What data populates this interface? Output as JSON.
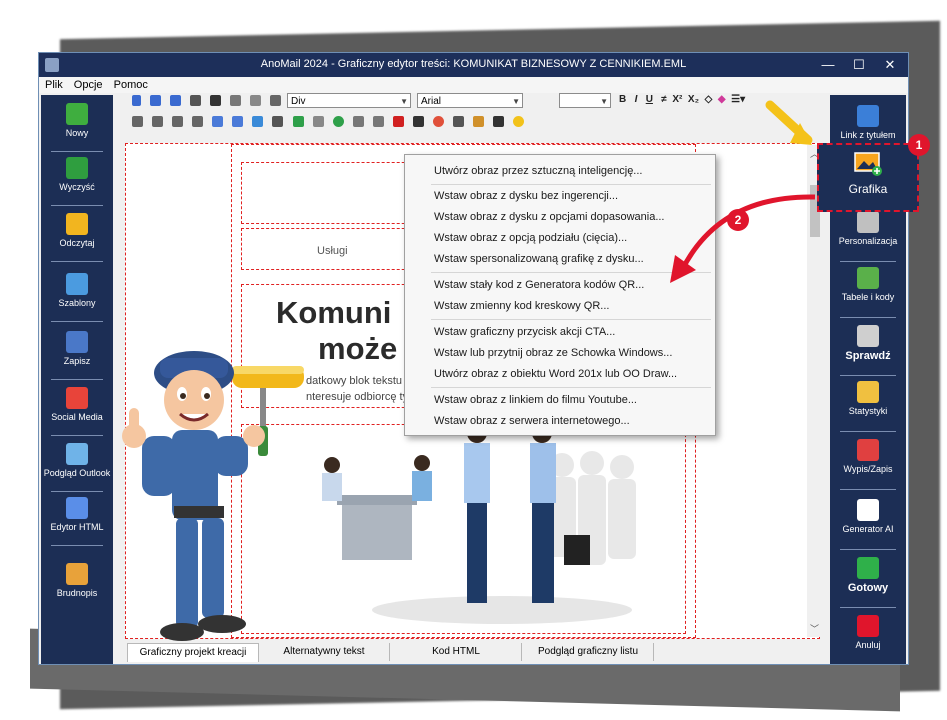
{
  "window": {
    "title": "AnoMail 2024 - Graficzny edytor treści: KOMUNIKAT BIZNESOWY Z CENNIKIEM.EML",
    "minimize": "—",
    "maximize": "☐",
    "close": "✕"
  },
  "menubar": [
    "Plik",
    "Opcje",
    "Pomoc"
  ],
  "toolbar": {
    "style_combo": "Div",
    "font_combo": "Arial",
    "size_combo": ""
  },
  "left_sidebar": [
    {
      "label": "Nowy",
      "icon": "new-document-icon",
      "color": "#3fae3f"
    },
    {
      "label": "Wyczyść",
      "icon": "recycle-icon",
      "color": "#2f9e3f"
    },
    {
      "label": "Odczytaj",
      "icon": "folder-open-icon",
      "color": "#f2b51f"
    },
    {
      "label": "Szablony",
      "icon": "templates-icon",
      "color": "#4b9be0"
    },
    {
      "label": "Zapisz",
      "icon": "save-icon",
      "color": "#4a78c8"
    },
    {
      "label": "Social Media",
      "icon": "social-media-icon",
      "color": "#e8443a"
    },
    {
      "label": "Podgląd Outlook",
      "icon": "outlook-icon",
      "color": "#6fb3e8"
    },
    {
      "label": "Edytor HTML",
      "icon": "html-editor-icon",
      "color": "#5a8ee8"
    },
    {
      "label": "Brudnopis",
      "icon": "draft-icon",
      "color": "#e8a23a"
    }
  ],
  "right_sidebar": [
    {
      "label": "Link z tytułem",
      "icon": "http-link-icon",
      "color": "#3b7fd8"
    },
    {
      "label": "Grafika",
      "icon": "image-icon",
      "color": "#e89a2a"
    },
    {
      "label": "Personalizacja",
      "icon": "personalization-icon",
      "color": "#c0c0c0"
    },
    {
      "label": "Tabele i kody",
      "icon": "table-icon",
      "color": "#5ab04a"
    },
    {
      "label": "Sprawdź",
      "icon": "spellcheck-icon",
      "color": "#cfcfcf"
    },
    {
      "label": "Statystyki",
      "icon": "statistics-icon",
      "color": "#f0c040"
    },
    {
      "label": "Wypis/Zapis",
      "icon": "unsubscribe-icon",
      "color": "#e04040"
    },
    {
      "label": "Generator AI",
      "icon": "ai-generator-icon",
      "color": "#ffffff"
    },
    {
      "label": "Gotowy",
      "icon": "ready-check-icon",
      "color": "#2fb04a"
    },
    {
      "label": "Anuluj",
      "icon": "cancel-icon",
      "color": "#e0152c"
    }
  ],
  "editor": {
    "nav_item": "Usługi",
    "headline_line1": "Komuni",
    "headline_line2": "może",
    "body_line1": "datkowy blok tekstu",
    "body_line2": "nteresuje odbiorcę tym co"
  },
  "context_menu": {
    "items": [
      "Utwórz obraz przez sztuczną inteligencję...",
      "Wstaw obraz z dysku bez ingerencji...",
      "Wstaw obraz z dysku z opcjami dopasowania...",
      "Wstaw obraz z opcją podziału (cięcia)...",
      "Wstaw spersonalizowaną grafikę z dysku...",
      "Wstaw stały kod z Generatora kodów QR...",
      "Wstaw zmienny kod kreskowy QR...",
      "Wstaw graficzny przycisk akcji CTA...",
      "Wstaw lub przytnij obraz ze Schowka Windows...",
      "Utwórz obraz z obiektu Word 201x lub OO Draw...",
      "Wstaw obraz z linkiem do filmu Youtube...",
      "Wstaw obraz z serwera internetowego..."
    ]
  },
  "tabs": [
    "Graficzny projekt kreacji",
    "Alternatywny tekst",
    "Kod HTML",
    "Podgląd graficzny listu"
  ],
  "annotations": {
    "badge1": "1",
    "badge2": "2"
  },
  "colors": {
    "accent_red": "#e0152c",
    "sidebar_bg": "#1c2e55",
    "title_bg": "#1d2f5a",
    "arrow_yellow": "#f4c21a"
  }
}
